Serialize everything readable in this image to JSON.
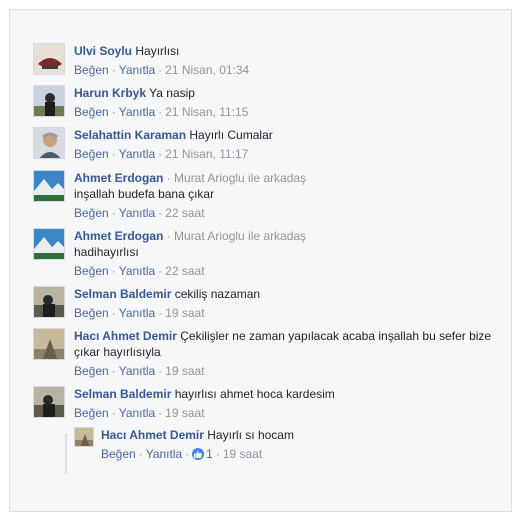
{
  "actions": {
    "like": "Beğen",
    "reply": "Yanıtla"
  },
  "comments": [
    {
      "author": "Ulvi Soylu",
      "text": "Hayırlısı",
      "time": "21 Nisan, 01:34"
    },
    {
      "author": "Harun Krbyk",
      "text": "Ya nasip",
      "time": "21 Nisan, 11:15"
    },
    {
      "author": "Selahattin Karaman",
      "text": "Hayırlı Cumalar",
      "time": "21 Nisan, 11:17"
    },
    {
      "author": "Ahmet Erdogan",
      "tag": "· Murat Arioglu ile arkadaş",
      "text": "inşallah budefa bana çıkar",
      "time": "22 saat"
    },
    {
      "author": "Ahmet Erdogan",
      "tag": "· Murat Arioglu ile arkadaş",
      "text": "hadihayırlısı",
      "time": "22 saat"
    },
    {
      "author": "Selman Baldemir",
      "text": "cekiliş nazaman",
      "time": "19 saat"
    },
    {
      "author": "Hacı Ahmet Demir",
      "text_line1": "Çekilişler ne zaman yapılacak acaba inşallah bu sefer bize",
      "text_line2": "çıkar hayırlısıyla",
      "time": "19 saat"
    },
    {
      "author": "Selman Baldemir",
      "text": "hayırlısı ahmet hoca kardesim",
      "time": "19 saat"
    }
  ],
  "reply": {
    "author": "Hacı Ahmet Demir",
    "text": "Hayırlı sı hocam",
    "likes": "1",
    "time": "19 saat"
  }
}
